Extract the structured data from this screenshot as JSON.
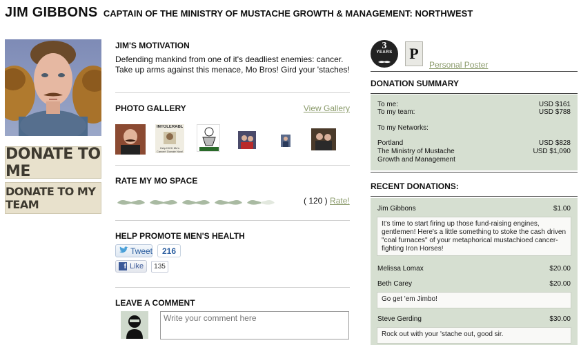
{
  "header": {
    "name": "JIM GIBBONS",
    "title": "CAPTAIN OF THE MINISTRY OF MUSTACHE GROWTH & MANAGEMENT: NORTHWEST"
  },
  "left": {
    "donate_me_label": "DONATE TO ME",
    "donate_team_label": "DONATE TO MY TEAM"
  },
  "motivation": {
    "heading": "JIM'S MOTIVATION",
    "text": "Defending mankind from one of it's deadliest enemies: cancer. Take up arms against this menace, Mo Bros! Gird your 'staches!"
  },
  "gallery": {
    "heading": "PHOTO GALLERY",
    "view_link": "View Gallery",
    "thumb_2_text": "INTOLERABLE",
    "thumb_2_subtext": "Help KICK Mo's Cancer! Donate Now!"
  },
  "rating": {
    "heading": "RATE MY MO SPACE",
    "stars": 5,
    "filled": 4.5,
    "count_open": "( 120 )",
    "rate_link": "Rate!"
  },
  "promote": {
    "heading": "HELP PROMOTE MEN'S HEALTH",
    "tweet_label": "Tweet",
    "tweet_count": "216",
    "like_label": "Like",
    "like_count": "135"
  },
  "comment": {
    "heading": "LEAVE A COMMENT",
    "placeholder": "Write your comment here"
  },
  "badges": {
    "years_number": "3",
    "years_label": "YEARS",
    "poster_letter": "P",
    "poster_link": "Personal Poster"
  },
  "summary": {
    "heading": "DONATION SUMMARY",
    "to_me_label": "To me:",
    "to_me_value": "USD $161",
    "to_team_label": "To my team:",
    "to_team_value": "USD $788",
    "networks_label": "To my Networks:",
    "networks": [
      {
        "name": "Portland",
        "value": "USD $828"
      },
      {
        "name": "The Ministry of Mustache",
        "value": "USD $1,090"
      },
      {
        "name": "Growth and Management",
        "value": ""
      }
    ]
  },
  "recent": {
    "heading": "RECENT DONATIONS:",
    "donations": [
      {
        "name": "Jim Gibbons",
        "amount": "$1.00",
        "message": "It's time to start firing up those fund-raising engines, gentlemen! Here's a little something to stoke the cash driven \"coal furnaces\" of your metaphorical mustachioed cancer-fighting Iron Horses!"
      },
      {
        "name": "Melissa Lomax",
        "amount": "$20.00",
        "message": ""
      },
      {
        "name": "Beth Carey",
        "amount": "$20.00",
        "message": "Go get 'em Jimbo!"
      },
      {
        "name": "Steve Gerding",
        "amount": "$30.00",
        "message": "Rock out with your 'stache out, good sir."
      }
    ]
  },
  "colors": {
    "panel_green": "#d6dfd1",
    "link_green": "#8a9a6a",
    "stache_green": "#a9baa2"
  }
}
